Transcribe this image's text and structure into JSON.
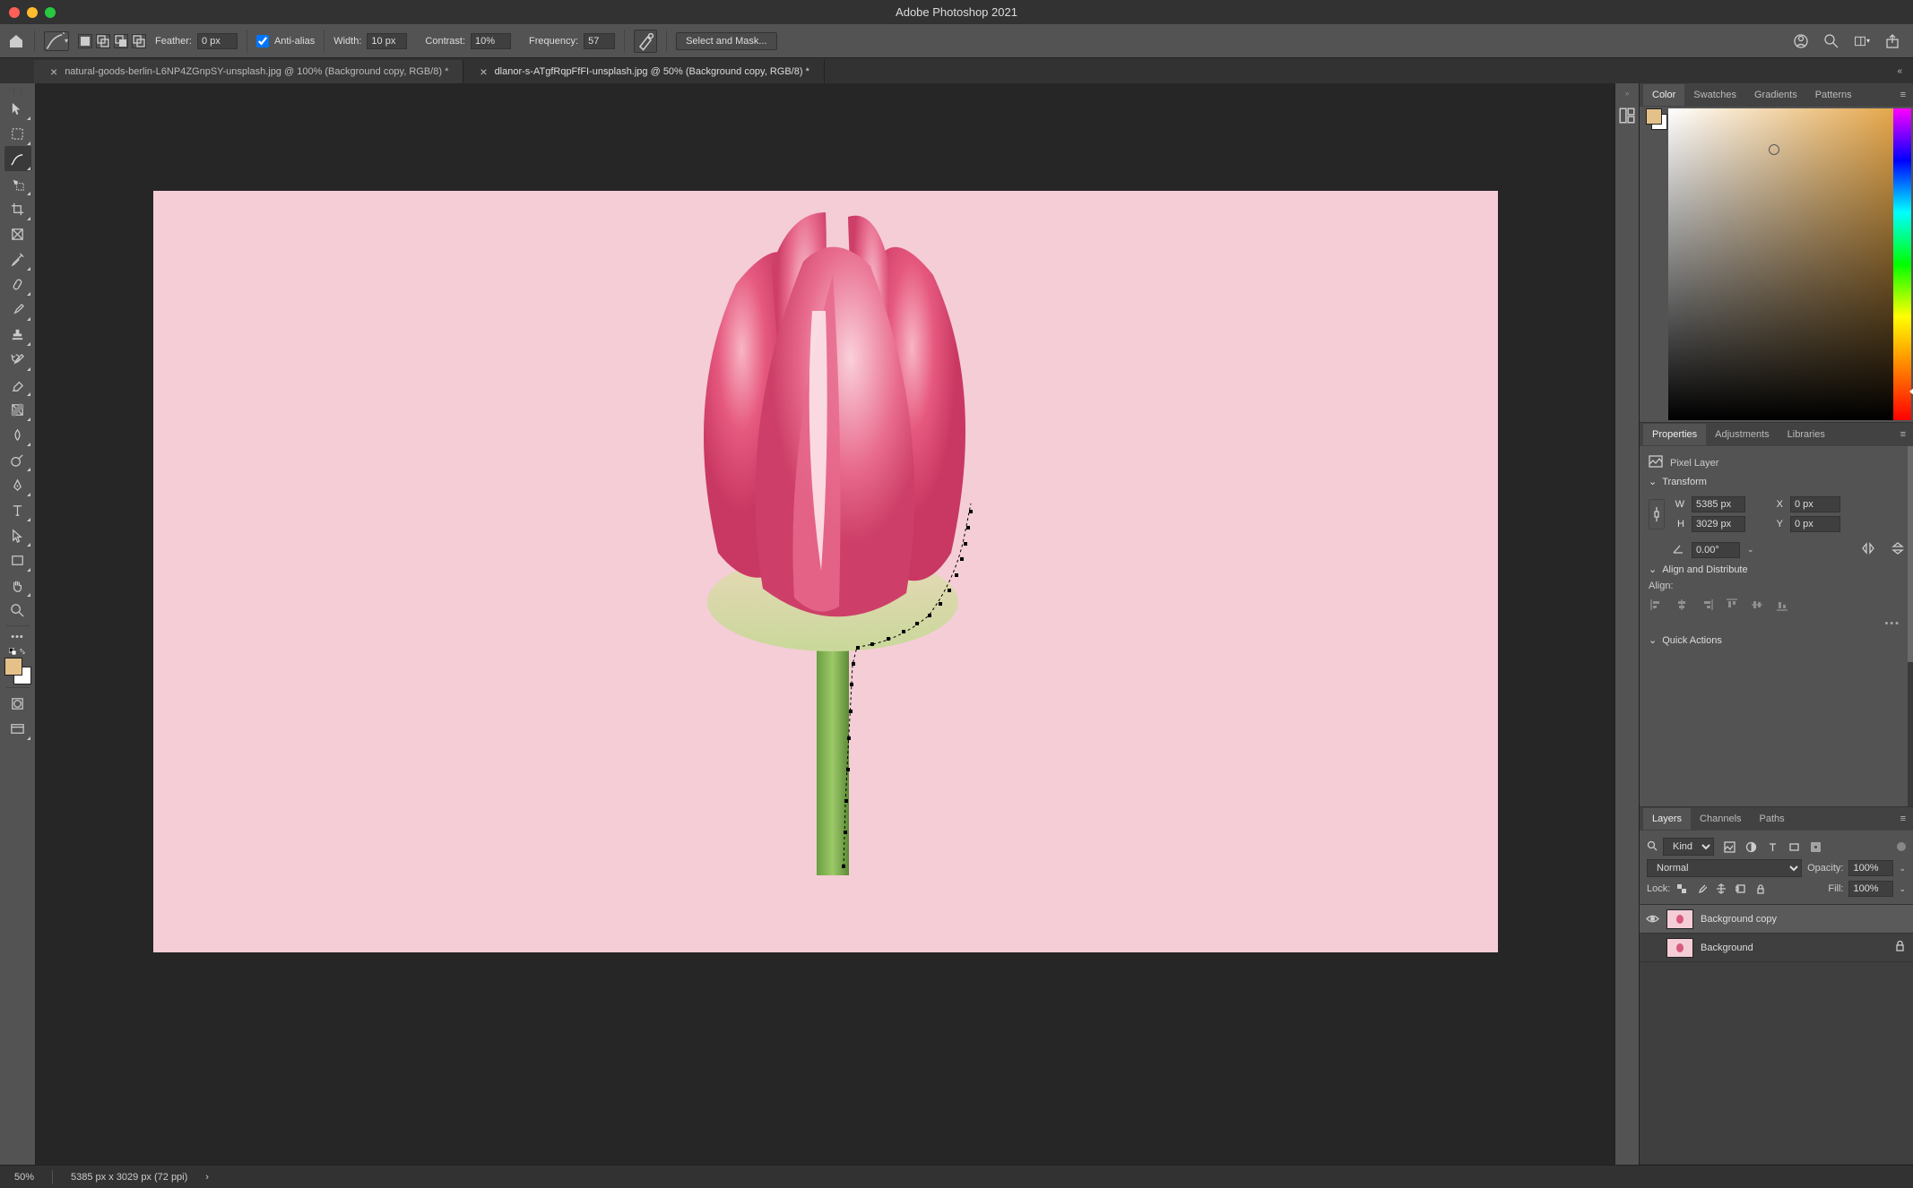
{
  "app": {
    "title": "Adobe Photoshop 2021"
  },
  "optionsbar": {
    "feather_label": "Feather:",
    "feather_value": "0 px",
    "antialias_label": "Anti-alias",
    "width_label": "Width:",
    "width_value": "10 px",
    "contrast_label": "Contrast:",
    "contrast_value": "10%",
    "frequency_label": "Frequency:",
    "frequency_value": "57",
    "select_mask_label": "Select and Mask..."
  },
  "tabs": [
    {
      "label": "natural-goods-berlin-L6NP4ZGnpSY-unsplash.jpg @ 100% (Background copy, RGB/8) *"
    },
    {
      "label": "dlanor-s-ATgfRqpFfFI-unsplash.jpg @ 50% (Background copy, RGB/8) *"
    }
  ],
  "panels": {
    "color": {
      "tabs": [
        "Color",
        "Swatches",
        "Gradients",
        "Patterns"
      ]
    },
    "properties": {
      "tabs": [
        "Properties",
        "Adjustments",
        "Libraries"
      ],
      "layer_type": "Pixel Layer",
      "transform_label": "Transform",
      "w_label": "W",
      "w_value": "5385 px",
      "h_label": "H",
      "h_value": "3029 px",
      "x_label": "X",
      "x_value": "0 px",
      "y_label": "Y",
      "y_value": "0 px",
      "angle_value": "0.00°",
      "align_label": "Align and Distribute",
      "align_sub": "Align:",
      "quick_label": "Quick Actions"
    },
    "layers": {
      "tabs": [
        "Layers",
        "Channels",
        "Paths"
      ],
      "filter_kind": "Kind",
      "blend_mode": "Normal",
      "opacity_label": "Opacity:",
      "opacity_value": "100%",
      "lock_label": "Lock:",
      "fill_label": "Fill:",
      "fill_value": "100%",
      "items": [
        {
          "name": "Background copy",
          "visible": true,
          "locked": false
        },
        {
          "name": "Background",
          "visible": false,
          "locked": true
        }
      ]
    }
  },
  "statusbar": {
    "zoom": "50%",
    "dims": "5385 px x 3029 px (72 ppi)"
  },
  "colors": {
    "foreground": "#e5c18a",
    "background": "#ffffff"
  }
}
